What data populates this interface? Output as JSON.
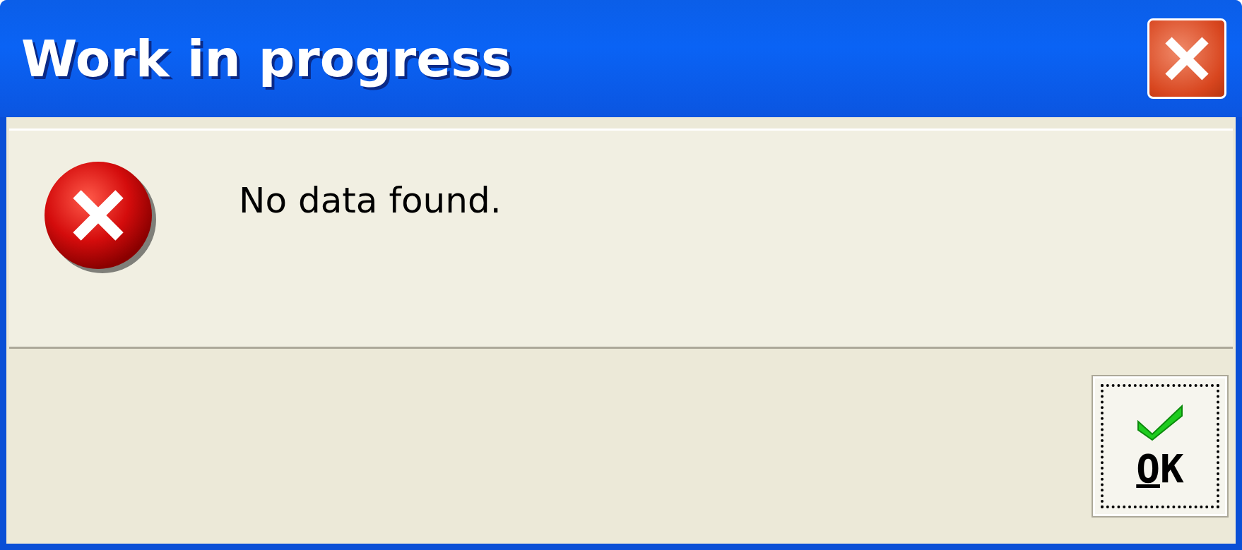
{
  "window": {
    "title": "Work in progress"
  },
  "message": {
    "kind": "error",
    "text": "No data found."
  },
  "buttons": [
    {
      "label": "OK",
      "focused": true
    }
  ]
}
